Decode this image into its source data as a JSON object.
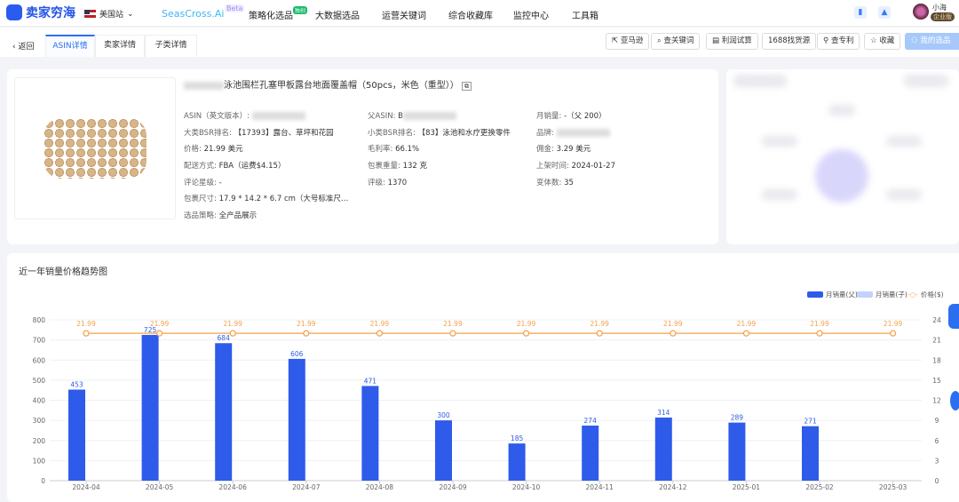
{
  "header": {
    "logo": "卖家穷海",
    "site": "美国站",
    "nav": [
      "SeasCross.Ai",
      "策略化选品",
      "大数据选品",
      "运营关键词",
      "综合收藏库",
      "监控中心",
      "工具箱"
    ],
    "beta": "Beta",
    "hot_badge": "独创",
    "user": "小海",
    "vip": "企业版"
  },
  "tabs": {
    "back": "返回",
    "items": [
      "ASIN详情",
      "卖家详情",
      "子类详情"
    ],
    "active": 0
  },
  "actions": [
    "亚马逊",
    "查关键词",
    "利润试算",
    "1688找货源",
    "查专利",
    "收藏",
    "我的选品"
  ],
  "product": {
    "title": "泳池围栏孔塞甲板露台地面覆盖帽（50pcs，米色（重型））",
    "fields": [
      {
        "label": "ASIN（英文版本）:",
        "value": ""
      },
      {
        "label": "父ASIN:",
        "value": "B"
      },
      {
        "label": "月销量:",
        "value": "-（父 200）"
      },
      {
        "label": "大类BSR排名:",
        "value": "【17393】露台、草坪和花园"
      },
      {
        "label": "小类BSR排名:",
        "value": "【83】泳池和水疗更换零件"
      },
      {
        "label": "品牌:",
        "value": ""
      },
      {
        "label": "价格:",
        "value": "21.99 美元"
      },
      {
        "label": "毛利率:",
        "value": "66.1%"
      },
      {
        "label": "佣金:",
        "value": "3.29 美元"
      },
      {
        "label": "配送方式:",
        "value": "FBA（运费$4.15）"
      },
      {
        "label": "包裹重量:",
        "value": "132 克"
      },
      {
        "label": "上架时间:",
        "value": "2024-01-27"
      },
      {
        "label": "评论星级:",
        "value": "-"
      },
      {
        "label": "评级:",
        "value": "1370"
      },
      {
        "label": "变体数:",
        "value": "35"
      },
      {
        "label": "包裹尺寸:",
        "value": "17.9 * 14.2 * 6.7 cm（大号标准尺…"
      },
      {
        "label": "选品策略:",
        "value": "全产品展示"
      }
    ]
  },
  "chart_section": {
    "title": "近一年销量价格趋势图"
  },
  "chart_data": {
    "type": "bar",
    "categories": [
      "2024-04",
      "2024-05",
      "2024-06",
      "2024-07",
      "2024-08",
      "2024-09",
      "2024-10",
      "2024-11",
      "2024-12",
      "2025-01",
      "2025-02",
      "2025-03"
    ],
    "series": [
      {
        "name": "月销量(父)",
        "type": "bar",
        "axis": "left",
        "color": "#2e5bea",
        "values": [
          453,
          725,
          684,
          606,
          471,
          300,
          185,
          274,
          314,
          289,
          271,
          null
        ]
      },
      {
        "name": "月销量(子)",
        "type": "bar",
        "axis": "left",
        "color": "#c3d1fb",
        "values": [
          null,
          null,
          null,
          null,
          null,
          null,
          null,
          null,
          null,
          null,
          null,
          null
        ]
      },
      {
        "name": "价格($)",
        "type": "line",
        "axis": "right",
        "color": "#f5a04a",
        "values": [
          21.99,
          21.99,
          21.99,
          21.99,
          21.99,
          21.99,
          21.99,
          21.99,
          21.99,
          21.99,
          21.99,
          21.99
        ]
      }
    ],
    "ylim": [
      0,
      800
    ],
    "yticks": [
      0,
      100,
      200,
      300,
      400,
      500,
      600,
      700,
      800
    ],
    "y2lim": [
      0,
      24
    ],
    "y2ticks": [
      0,
      3,
      6,
      9,
      12,
      15,
      18,
      21,
      24
    ],
    "grid": true,
    "legend": "top-right"
  }
}
